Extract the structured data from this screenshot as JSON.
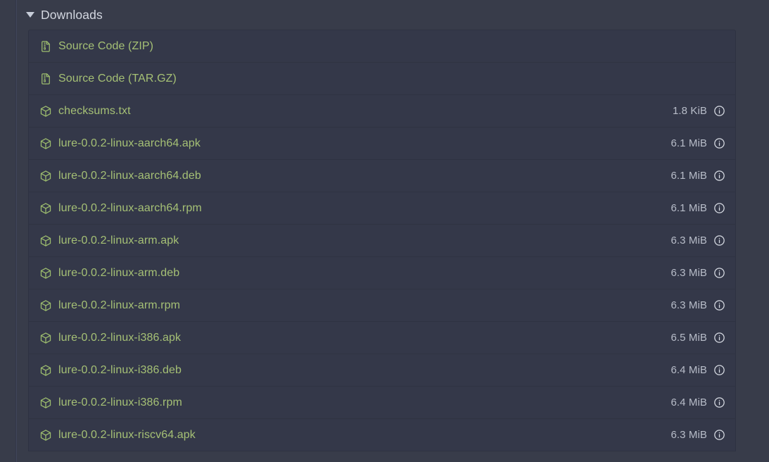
{
  "section": {
    "title": "Downloads",
    "disclosure_icon": "triangle-down-icon",
    "expanded": true
  },
  "colors": {
    "page_background": "#383c4a",
    "row_background": "#343849",
    "row_divider": "#2f3342",
    "link_green": "#a5c075",
    "size_text": "#b8bdc9",
    "header_text": "#d3d7e0"
  },
  "downloads": {
    "info_icon": "info-circle-icon",
    "rows": [
      {
        "icon": "file-archive-icon",
        "name": "Source Code (ZIP)",
        "size": ""
      },
      {
        "icon": "file-archive-icon",
        "name": "Source Code (TAR.GZ)",
        "size": ""
      },
      {
        "icon": "package-box-icon",
        "name": "checksums.txt",
        "size": "1.8 KiB"
      },
      {
        "icon": "package-box-icon",
        "name": "lure-0.0.2-linux-aarch64.apk",
        "size": "6.1 MiB"
      },
      {
        "icon": "package-box-icon",
        "name": "lure-0.0.2-linux-aarch64.deb",
        "size": "6.1 MiB"
      },
      {
        "icon": "package-box-icon",
        "name": "lure-0.0.2-linux-aarch64.rpm",
        "size": "6.1 MiB"
      },
      {
        "icon": "package-box-icon",
        "name": "lure-0.0.2-linux-arm.apk",
        "size": "6.3 MiB"
      },
      {
        "icon": "package-box-icon",
        "name": "lure-0.0.2-linux-arm.deb",
        "size": "6.3 MiB"
      },
      {
        "icon": "package-box-icon",
        "name": "lure-0.0.2-linux-arm.rpm",
        "size": "6.3 MiB"
      },
      {
        "icon": "package-box-icon",
        "name": "lure-0.0.2-linux-i386.apk",
        "size": "6.5 MiB"
      },
      {
        "icon": "package-box-icon",
        "name": "lure-0.0.2-linux-i386.deb",
        "size": "6.4 MiB"
      },
      {
        "icon": "package-box-icon",
        "name": "lure-0.0.2-linux-i386.rpm",
        "size": "6.4 MiB"
      },
      {
        "icon": "package-box-icon",
        "name": "lure-0.0.2-linux-riscv64.apk",
        "size": "6.3 MiB"
      }
    ]
  }
}
